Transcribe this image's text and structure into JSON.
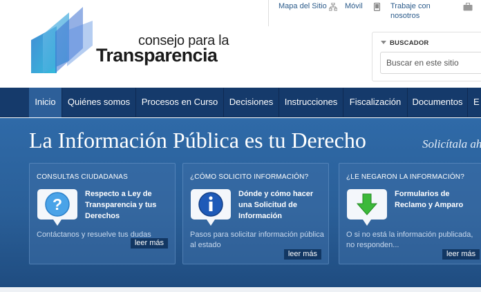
{
  "logo": {
    "line1": "consejo para la",
    "line2": "Transparencia"
  },
  "toplinks": [
    {
      "label": "Mapa del Sitio",
      "icon": "sitemap-icon"
    },
    {
      "label": "Móvil",
      "icon": "mobile-icon"
    },
    {
      "label": "Trabaje con nosotros",
      "icon": "briefcase-icon"
    }
  ],
  "search": {
    "label": "BUSCADOR",
    "placeholder": "Buscar en este sitio"
  },
  "nav": [
    {
      "label": "Inicio",
      "active": true
    },
    {
      "label": "Quiénes somos"
    },
    {
      "label": "Procesos en Curso"
    },
    {
      "label": "Decisiones"
    },
    {
      "label": "Instrucciones"
    },
    {
      "label": "Fiscalización"
    },
    {
      "label": "Documentos"
    },
    {
      "label": "E"
    }
  ],
  "hero": {
    "title": "La Información Pública es tu Derecho",
    "tagline": "Solicítala aho"
  },
  "cards": [
    {
      "heading": "CONSULTAS CIUDADANAS",
      "icon": "question-icon",
      "title": "Respecto a Ley de Transparencia y tus Derechos",
      "desc": "Contáctanos y resuelve tus dudas",
      "more": "leer más"
    },
    {
      "heading": "¿CÓMO SOLICITO INFORMACIÓN?",
      "icon": "info-icon",
      "title": "Dónde y cómo hacer una Solicitud de Información",
      "desc": "Pasos para solicitar información pública al estado",
      "more": "leer más"
    },
    {
      "heading": "¿LE NEGARON LA INFORMACIÓN?",
      "icon": "download-arrow-icon",
      "title": "Formularios de Reclamo y Amparo",
      "desc": "O si no está la información publicada, no responden...",
      "more": "leer más"
    }
  ],
  "colors": {
    "nav_bg": "#153a6b",
    "nav_active": "#2d5f99",
    "hero_bg": "#2a5f98",
    "link": "#2a5a8a"
  }
}
